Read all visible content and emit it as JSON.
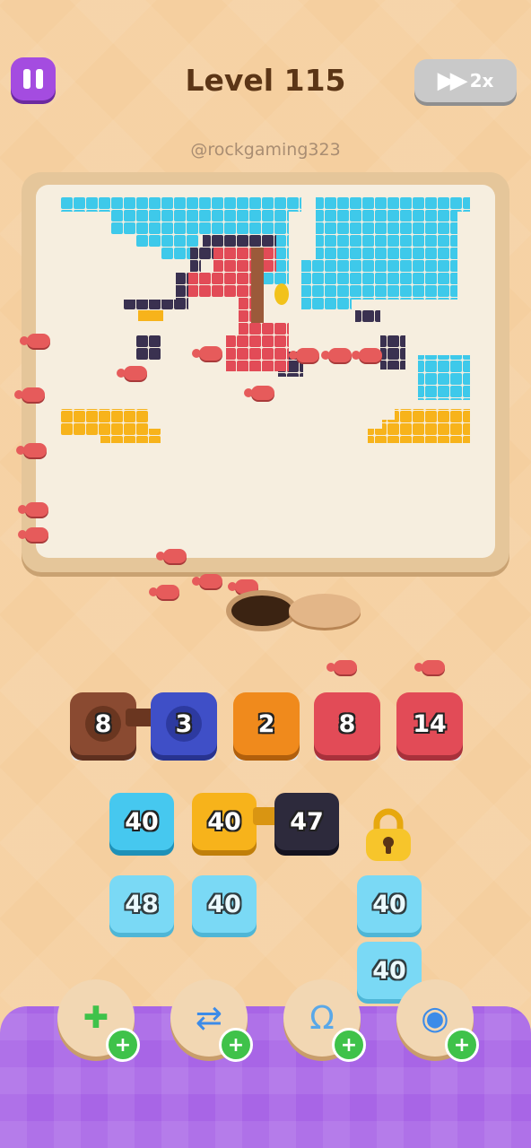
{
  "header": {
    "title": "Level 115",
    "speed_label": "2x",
    "watermark": "@rockgaming323"
  },
  "queue": [
    {
      "value": "8",
      "color": "#8a4a31",
      "connected_to_next": true
    },
    {
      "value": "3",
      "color": "#3f4fc7",
      "connected_to_next": false
    },
    {
      "value": "2",
      "color": "#f08a1c",
      "connected_to_next": false
    },
    {
      "value": "8",
      "color": "#e24b57",
      "connected_to_next": false
    },
    {
      "value": "14",
      "color": "#e24b57",
      "connected_to_next": false
    }
  ],
  "grid": {
    "row1": [
      {
        "value": "40",
        "color": "#46c8ef"
      },
      {
        "value": "40",
        "color": "#f7b31b"
      },
      {
        "value": "47",
        "color": "#2d2a3c"
      }
    ],
    "row2": [
      {
        "value": "48",
        "color": "#7ad9f5"
      },
      {
        "value": "40",
        "color": "#7ad9f5"
      },
      {
        "value": "40",
        "color": "#7ad9f5"
      }
    ],
    "row3": [
      {
        "value": "40",
        "color": "#7ad9f5"
      }
    ]
  },
  "boosters": [
    {
      "icon": "add-slot-icon"
    },
    {
      "icon": "shuffle-arrows-icon"
    },
    {
      "icon": "magnet-icon"
    },
    {
      "icon": "spool-icon"
    }
  ],
  "colors": {
    "cyan": "#3ec9ea",
    "navy": "#3a3150",
    "red": "#e24b57",
    "brown": "#8a4a31",
    "yellow": "#f7b31b",
    "purple": "#a865e6"
  }
}
